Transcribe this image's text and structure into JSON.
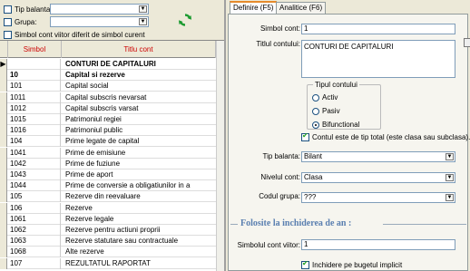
{
  "filters": {
    "tip_balanta_label": "Tip balanta:",
    "grupa_label": "Grupa:",
    "simbol_viitor_label": "Simbol cont viitor diferit de simbol curent",
    "tip_balanta_value": "",
    "grupa_value": ""
  },
  "grid": {
    "columns": [
      "Simbol",
      "Titlu cont"
    ],
    "rows": [
      {
        "simbol": "",
        "titlu": "CONTURI DE CAPITALURI",
        "bold": true,
        "current": true
      },
      {
        "simbol": "10",
        "titlu": "Capital si rezerve",
        "bold": true
      },
      {
        "simbol": "101",
        "titlu": "Capital social"
      },
      {
        "simbol": "1011",
        "titlu": "Capital subscris nevarsat"
      },
      {
        "simbol": "1012",
        "titlu": "Capital subscris varsat"
      },
      {
        "simbol": "1015",
        "titlu": "Patrimoniul regiei"
      },
      {
        "simbol": "1016",
        "titlu": "Patrimoniul public"
      },
      {
        "simbol": "104",
        "titlu": "Prime legate de capital"
      },
      {
        "simbol": "1041",
        "titlu": "Prime de emisiune"
      },
      {
        "simbol": "1042",
        "titlu": "Prime de fuziune"
      },
      {
        "simbol": "1043",
        "titlu": "Prime de aport"
      },
      {
        "simbol": "1044",
        "titlu": "Prime de conversie a obligatiunilor in a"
      },
      {
        "simbol": "105",
        "titlu": "Rezerve din reevaluare"
      },
      {
        "simbol": "106",
        "titlu": "Rezerve"
      },
      {
        "simbol": "1061",
        "titlu": "Rezerve legale"
      },
      {
        "simbol": "1062",
        "titlu": "Rezerve pentru actiuni proprii"
      },
      {
        "simbol": "1063",
        "titlu": "Rezerve statutare sau contractuale"
      },
      {
        "simbol": "1068",
        "titlu": "Alte rezerve"
      },
      {
        "simbol": "107",
        "titlu": "REZULTATUL RAPORTAT"
      }
    ]
  },
  "tabs": [
    {
      "label": "Definire (F5)",
      "active": true
    },
    {
      "label": "Analitice (F6)",
      "active": false
    }
  ],
  "form": {
    "simbol_cont_label": "Simbol cont:",
    "simbol_cont_value": "1",
    "titlu_label": "Titlul contului:",
    "titlu_value": "CONTURI DE CAPITALURI",
    "tipul_group_label": "Tipul contului",
    "tip_options": [
      {
        "label": "Activ",
        "selected": false
      },
      {
        "label": "Pasiv",
        "selected": false
      },
      {
        "label": "Bifunctional",
        "selected": true
      }
    ],
    "cont_total_label": "Contul este de tip total (este clasa sau subclasa).",
    "cont_total_checked": true,
    "tip_balanta_label": "Tip balanta:",
    "tip_balanta_value": "Bilant",
    "nivel_label": "Nivelul cont:",
    "nivel_value": "Clasa",
    "codul_grupa_label": "Codul grupa:",
    "codul_grupa_value": "???",
    "section_title": "Folosite la inchiderea de an :",
    "simbol_viitor_label": "Simbolul cont viitor:",
    "simbol_viitor_value": "1",
    "inchidere_label": "Inchidere pe bugetul implicit",
    "inchidere_checked": true
  },
  "colors": {
    "header_text": "#cc0000",
    "active_tab_accent": "#e68b2c",
    "section_title": "#5a7fb0",
    "checkmark": "#21a121"
  }
}
